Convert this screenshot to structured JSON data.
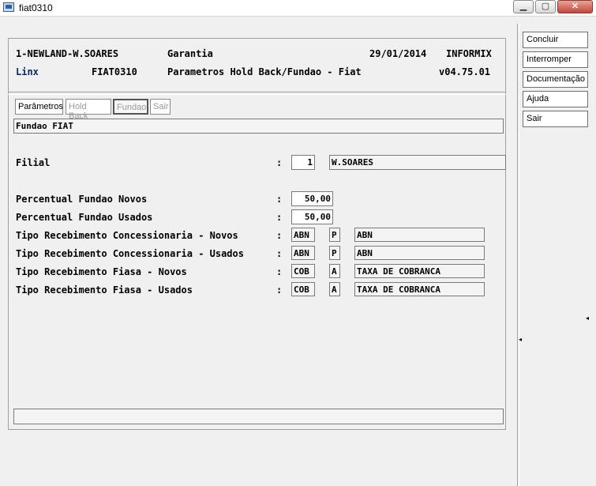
{
  "window": {
    "title": "fiat0310",
    "min": "▁",
    "max": "▢",
    "close": "✕"
  },
  "header": {
    "company": "1-NEWLAND-W.SOARES",
    "module": "Garantia",
    "date": "29/01/2014",
    "db": "INFORMIX",
    "vendor": "Linx",
    "program": "FIAT0310",
    "description": "Parametros Hold Back/Fundao - Fiat",
    "version": "v04.75.01"
  },
  "commands": [
    "Concluir",
    "Interromper",
    "Documentação",
    "Ajuda",
    "Sair"
  ],
  "tabs": [
    "Parâmetros",
    "Hold Back",
    "Fundao",
    "Sair"
  ],
  "section_title": "Fundao FIAT",
  "form": {
    "filial": {
      "label": "Filial",
      "colon": ":",
      "code": "1",
      "name": "W.SOARES"
    },
    "perc_novos": {
      "label": "Percentual Fundao Novos",
      "colon": ":",
      "value": "50,00"
    },
    "perc_usados": {
      "label": "Percentual Fundao Usados",
      "colon": ":",
      "value": "50,00"
    },
    "rows": [
      {
        "label": "Tipo Recebimento Concessionaria - Novos",
        "colon": ":",
        "code": "ABN",
        "flag": "P",
        "desc": "ABN"
      },
      {
        "label": "Tipo Recebimento Concessionaria - Usados",
        "colon": ":",
        "code": "ABN",
        "flag": "P",
        "desc": "ABN"
      },
      {
        "label": "Tipo Recebimento Fiasa - Novos",
        "colon": ":",
        "code": "COB",
        "flag": "A",
        "desc": "TAXA DE COBRANCA"
      },
      {
        "label": "Tipo Recebimento Fiasa - Usados",
        "colon": ":",
        "code": "COB",
        "flag": "A",
        "desc": "TAXA DE COBRANCA"
      }
    ]
  },
  "status_bar": {
    "text": ""
  }
}
